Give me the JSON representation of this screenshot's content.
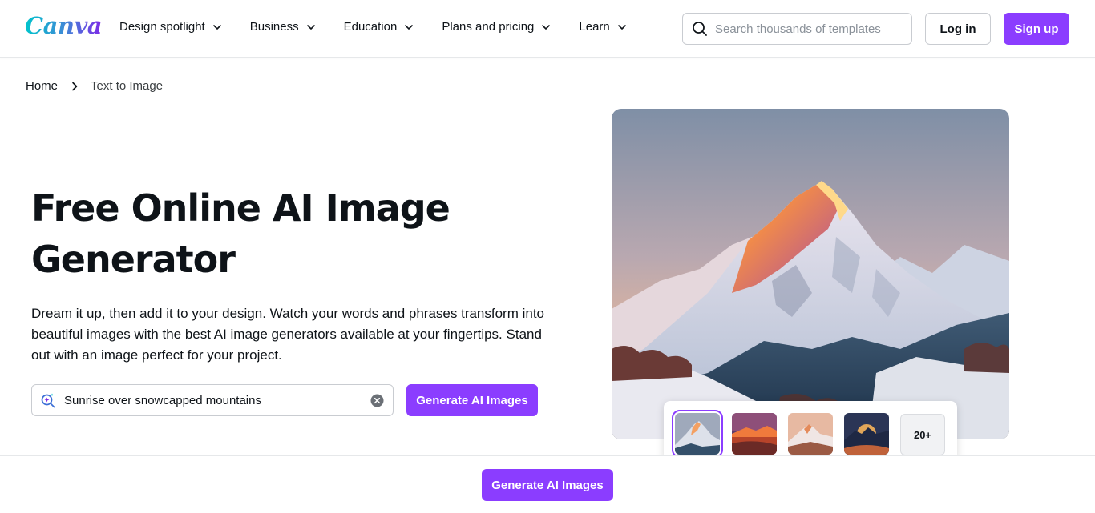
{
  "header": {
    "logo_text": "Canva",
    "nav": [
      {
        "label": "Design spotlight"
      },
      {
        "label": "Business"
      },
      {
        "label": "Education"
      },
      {
        "label": "Plans and pricing"
      },
      {
        "label": "Learn"
      }
    ],
    "search": {
      "placeholder": "Search thousands of templates",
      "icon": "search-icon"
    },
    "login_label": "Log in",
    "signup_label": "Sign up"
  },
  "breadcrumb": {
    "home": "Home",
    "current": "Text to Image"
  },
  "hero": {
    "title": "Free Online AI Image Generator",
    "description": "Dream it up, then add it to your design. Watch your words and phrases transform into beautiful images with the best AI image generators available at your fingertips. Stand out with an image perfect for your project.",
    "prompt_value": "Sunrise over snowcapped mountains",
    "generate_label": "Generate AI Images"
  },
  "gallery": {
    "more_label": "20+",
    "selected_index": 0
  },
  "sticky": {
    "generate_label": "Generate AI Images"
  },
  "colors": {
    "brand_purple": "#8b3dff",
    "text": "#0e1318",
    "border": "#c9ccd1"
  }
}
